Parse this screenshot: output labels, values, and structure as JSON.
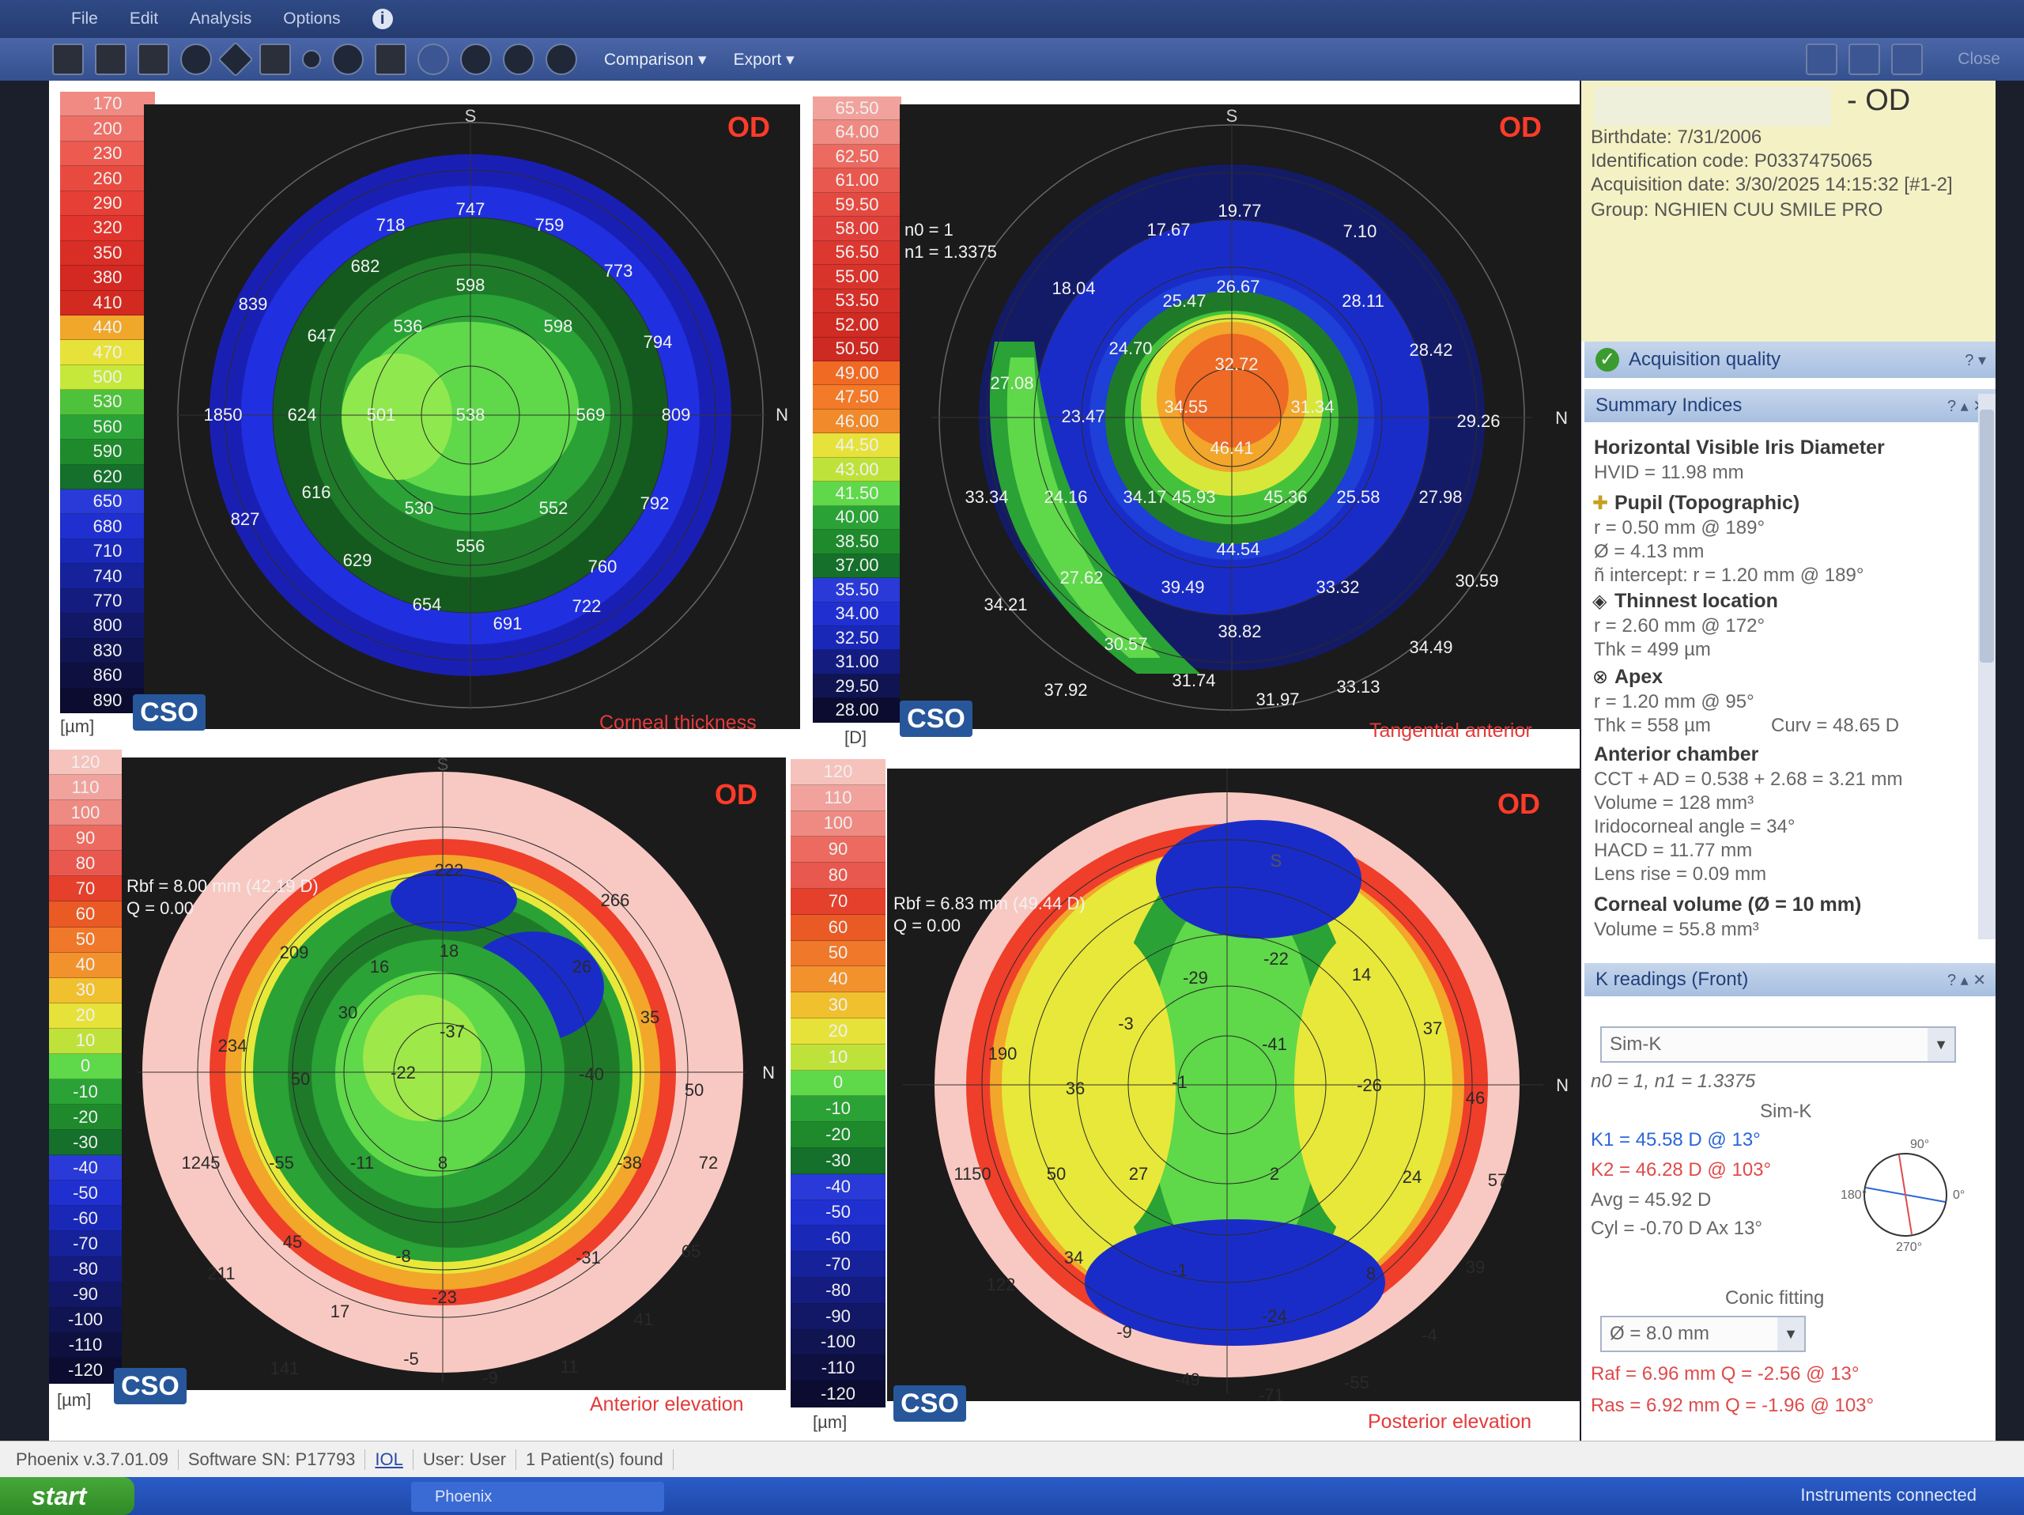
{
  "menubar": {
    "items": [
      "File",
      "Edit",
      "Analysis",
      "Options"
    ]
  },
  "toolbar": {
    "comparison": "Comparison ▾",
    "export": "Export ▾",
    "close": "Close"
  },
  "colors": {
    "red": "#e33a3a",
    "od": "#ff3b2a",
    "blue_text": "#2a66d8"
  },
  "maps": {
    "thickness": {
      "title": "Corneal thickness",
      "od": "OD",
      "unit": "[µm]",
      "scale": [
        "170",
        "200",
        "230",
        "260",
        "290",
        "320",
        "350",
        "380",
        "410",
        "440",
        "470",
        "500",
        "530",
        "560",
        "590",
        "620",
        "650",
        "680",
        "710",
        "740",
        "770",
        "800",
        "830",
        "860",
        "890"
      ],
      "labels": {
        "S": "S",
        "N": "N"
      },
      "values": [
        "747",
        "718",
        "759",
        "682",
        "598",
        "773",
        "839",
        "647",
        "536",
        "598",
        "794",
        "1850",
        "624",
        "501",
        "538",
        "569",
        "809",
        "616",
        "530",
        "552",
        "792",
        "827",
        "556",
        "629",
        "760",
        "654",
        "691",
        "722"
      ]
    },
    "tangential": {
      "title": "Tangential anterior",
      "od": "OD",
      "unit": "[D]",
      "n0": "n0 = 1",
      "n1": "n1 = 1.3375",
      "scale": [
        "65.50",
        "64.00",
        "62.50",
        "61.00",
        "59.50",
        "58.00",
        "56.50",
        "55.00",
        "53.50",
        "52.00",
        "50.50",
        "49.00",
        "47.50",
        "46.00",
        "44.50",
        "43.00",
        "41.50",
        "40.00",
        "38.50",
        "37.00",
        "35.50",
        "34.00",
        "32.50",
        "31.00",
        "29.50",
        "28.00"
      ],
      "labels": {
        "S": "S",
        "N": "N"
      },
      "values": [
        "17.67",
        "19.77",
        "7.10",
        "18.04",
        "25.47",
        "26.67",
        "28.11",
        "24.70",
        "28.42",
        "27.08",
        "32.72",
        "23.47",
        "34.55",
        "31.34",
        "29.26",
        "46.41",
        "33.34",
        "24.16",
        "34.17",
        "45.93",
        "45.36",
        "25.58",
        "27.98",
        "44.54",
        "27.62",
        "39.49",
        "33.32",
        "30.59",
        "34.21",
        "38.82",
        "30.57",
        "34.49",
        "37.92",
        "31.74",
        "31.97",
        "33.13"
      ]
    },
    "anterior": {
      "title": "Anterior elevation",
      "od": "OD",
      "unit": "[µm]",
      "rbf": "Rbf = 8.00 mm (42.19 D)",
      "q": "Q = 0.00",
      "scale": [
        "120",
        "110",
        "100",
        "90",
        "80",
        "70",
        "60",
        "50",
        "40",
        "30",
        "20",
        "10",
        "0",
        "-10",
        "-20",
        "-30",
        "-40",
        "-50",
        "-60",
        "-70",
        "-80",
        "-90",
        "-100",
        "-110",
        "-120"
      ],
      "labels": {
        "S": "S",
        "N": "N"
      },
      "values": [
        "222",
        "266",
        "209",
        "18",
        "16",
        "26",
        "30",
        "35",
        "-37",
        "234",
        "-22",
        "-40",
        "50",
        "50",
        "1245",
        "-55",
        "-11",
        "8",
        "-38",
        "72",
        "45",
        "-8",
        "-31",
        "65",
        "211",
        "-23",
        "17",
        "41",
        "-5",
        "-9",
        "11",
        "141"
      ]
    },
    "posterior": {
      "title": "Posterior elevation",
      "od": "OD",
      "unit": "[µm]",
      "rbf": "Rbf = 6.83 mm (49.44 D)",
      "q": "Q = 0.00",
      "scale": [
        "120",
        "110",
        "100",
        "90",
        "80",
        "70",
        "60",
        "50",
        "40",
        "30",
        "20",
        "10",
        "0",
        "-10",
        "-20",
        "-30",
        "-40",
        "-50",
        "-60",
        "-70",
        "-80",
        "-90",
        "-100",
        "-110",
        "-120"
      ],
      "labels": {
        "S": "S",
        "N": "N"
      },
      "values": [
        "-29",
        "-22",
        "14",
        "-3",
        "37",
        "190",
        "-41",
        "36",
        "-1",
        "-26",
        "46",
        "1150",
        "50",
        "27",
        "2",
        "24",
        "57",
        "34",
        "-1",
        "8",
        "39",
        "122",
        "-9",
        "-24",
        "-4",
        "-49",
        "-71",
        "-55"
      ]
    }
  },
  "patient": {
    "eye": "- OD",
    "birthdate": "Birthdate: 7/31/2006",
    "id": "Identification code: P0337475065",
    "acq": "Acquisition date: 3/30/2025 14:15:32 [#1-2]",
    "group": "Group: NGHIEN CUU SMILE PRO"
  },
  "panel": {
    "acq_quality": "Acquisition quality",
    "summary": "Summary Indices",
    "hvid_head": "Horizontal Visible Iris Diameter",
    "hvid": "HVID = 11.98 mm",
    "pupil_head": "Pupil (Topographic)",
    "pupil_r": "r = 0.50 mm @ 189°",
    "pupil_d": "Ø = 4.13 mm",
    "pupil_int": "ñ intercept: r = 1.20 mm @ 189°",
    "thin_head": "Thinnest location",
    "thin_r": "r = 2.60 mm @ 172°",
    "thin_thk": "Thk = 499 µm",
    "apex_head": "Apex",
    "apex_r": "r = 1.20 mm @ 95°",
    "apex_thk": "Thk = 558 µm",
    "apex_curv": "Curv = 48.65 D",
    "ac_head": "Anterior chamber",
    "ac_cct": "CCT + AD = 0.538 + 2.68 = 3.21 mm",
    "ac_vol": "Volume = 128 mm³",
    "ac_angle": "Iridocorneal angle = 34°",
    "ac_hacd": "HACD = 11.77 mm",
    "ac_lens": "Lens rise = 0.09 mm",
    "cv_head": "Corneal volume (Ø = 10 mm)",
    "cv_vol": "Volume = 55.8 mm³",
    "k_head": "K readings (Front)",
    "simk_select": "Sim-K",
    "nfactor": "n0 = 1, n1 = 1.3375",
    "simk": "Sim-K",
    "k1": "K1 = 45.58 D  @ 13°",
    "k2": "K2 = 46.28 D  @ 103°",
    "avg": "Avg = 45.92 D",
    "cyl": "Cyl = -0.70 D Ax 13°",
    "deg90": "90°",
    "deg180": "180°",
    "deg0": "0°",
    "deg270": "270°",
    "conic": "Conic fitting",
    "diam_select": "Ø = 8.0 mm",
    "raf": "Raf = 6.96 mm  Q = -2.56 @ 13°",
    "ras": "Ras = 6.92 mm  Q = -1.96 @ 103°"
  },
  "status": {
    "app": "Phoenix  v.3.7.01.09",
    "sn": "Software SN: P17793",
    "iol": "IOL",
    "user": "User: User",
    "patients": "1 Patient(s) found"
  },
  "taskbar": {
    "start": "start",
    "item": "Phoenix",
    "instruments": "Instruments connected"
  }
}
